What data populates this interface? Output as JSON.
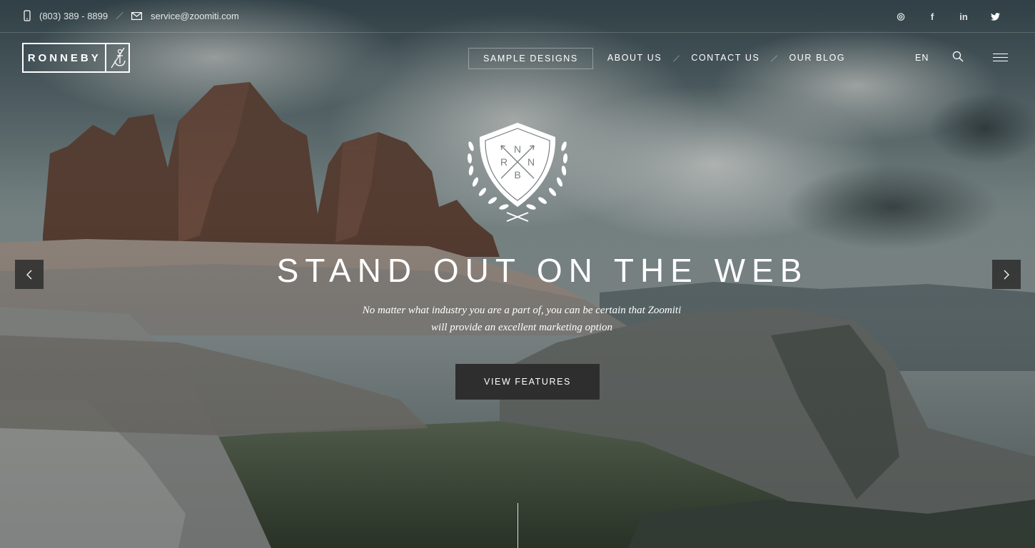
{
  "topbar": {
    "phone": "(803) 389 - 8899",
    "email": "service@zoomiti.com",
    "socials": [
      {
        "icon": "dribbble-icon",
        "glyph": "◎"
      },
      {
        "icon": "facebook-icon",
        "glyph": "f"
      },
      {
        "icon": "linkedin-icon",
        "glyph": "in"
      },
      {
        "icon": "twitter-icon",
        "glyph": "🐦"
      }
    ]
  },
  "header": {
    "logo_text": "RONNEBY",
    "nav": [
      "SAMPLE DESIGNS",
      "ABOUT US",
      "CONTACT US",
      "OUR BLOG"
    ],
    "active_nav": "SAMPLE DESIGNS",
    "language": "EN"
  },
  "hero": {
    "emblem_letters": {
      "top": "N",
      "left": "R",
      "right": "N",
      "bottom": "B"
    },
    "headline": "STAND OUT ON THE WEB",
    "subline_1": "No matter what industry you are a part of, you can be certain that Zoomiti",
    "subline_2": "will provide an excellent marketing option",
    "cta_label": "VIEW FEATURES"
  },
  "colors": {
    "button_bg": "#2e2e2e",
    "text": "#ffffff"
  }
}
